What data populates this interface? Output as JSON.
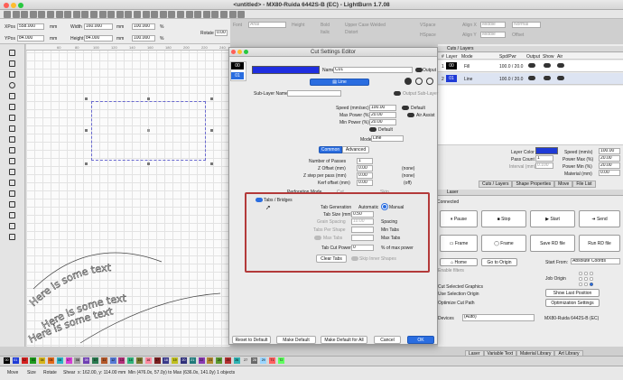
{
  "window": {
    "title": "<untitled> - MX80-Ruida 6442S-B (EC) - LightBurn 1.7.08"
  },
  "controls": {
    "xpos_label": "XPos",
    "xpos": "558.000",
    "ypos_label": "YPos",
    "ypos": "84.000",
    "unit": "mm",
    "width_label": "Width",
    "width": "160.000",
    "height_label": "Height",
    "height": "84.000",
    "pct1": "100.000",
    "pct2": "100.000",
    "pct_sym": "%",
    "rotate_label": "Rotate",
    "rotate": "0.00",
    "mm_btn": "mm"
  },
  "toolbar_text": {
    "font_label": "Font",
    "font_value": "Arial",
    "height_label": "Height",
    "bold": "Bold",
    "italic": "Italic",
    "upper_case": "Upper Case",
    "distort": "Distort",
    "welded": "Welded",
    "vspace_label": "VSpace",
    "hspace_label": "HSpace",
    "align_x": "Align X",
    "align_x_val": "Middle",
    "align_y": "Align Y",
    "align_y_val": "Middle",
    "offset_label": "Offset",
    "normal": "Normal"
  },
  "ruler": {
    "ticks": [
      "60",
      "80",
      "100",
      "120",
      "140",
      "160",
      "180",
      "200",
      "220",
      "240"
    ]
  },
  "canvas": {
    "text_line": "Here is some text"
  },
  "dialog": {
    "title": "Cut Settings Editor",
    "layers": [
      {
        "num": "00"
      },
      {
        "num": "01"
      }
    ],
    "name_label": "Name",
    "name_value": "C01",
    "output_label": "Output",
    "line_btn": "Line",
    "sublayer_label": "Sub-Layer Name",
    "output_sublayer": "Output Sub-Layer",
    "speed_label": "Speed (mm/sec)",
    "speed": "100.00",
    "default1": "Default",
    "maxpower_label": "Max Power (%)",
    "maxpower": "20.00",
    "air_assist": "Air Assist",
    "minpower_label": "Min Power (%)",
    "minpower": "20.00",
    "default2": "Default",
    "mode_label": "Mode",
    "mode_value": "Line",
    "tab_common": "Common",
    "tab_advanced": "Advanced",
    "passes_label": "Number of Passes",
    "passes": "1",
    "zoffset_label": "Z Offset (mm)",
    "zoffset": "0.00",
    "none1": "(none)",
    "zstep_label": "Z step per pass (mm)",
    "zstep": "0.00",
    "none2": "(none)",
    "kerf_label": "Kerf offset (mm)",
    "kerf": "0.00",
    "off": "(off)",
    "perf_label": "Perforation Mode",
    "perf_cut": "Cut",
    "perf_skip": "Skip",
    "tabs_title": "Tabs / Bridges",
    "tabgen_label": "Tab Generation",
    "automatic": "Automatic",
    "manual": "Manual",
    "tabsize_label": "Tab Size (mm)",
    "tabsize": "0.50",
    "grain_label": "Grain Spacing",
    "grain_val": "10.00",
    "spacing": "Spacing",
    "tabspershape_label": "Tabs Per Shape",
    "mintabs": "Min Tabs",
    "maxtabs_toggle": "Max Tabs",
    "maxtabs": "Max Tabs",
    "tabcut_label": "Tab Cut Power",
    "tabcut": "0",
    "pct_max": "% of max power",
    "clear_tabs": "Clear Tabs",
    "skip_inner": "Skip Inner Shapes",
    "reset": "Reset to Default",
    "make_default": "Make Default",
    "make_default_all": "Make Default for All",
    "cancel": "Cancel",
    "ok": "OK"
  },
  "cuts_panel": {
    "title": "Cuts / Layers",
    "headers": [
      "#",
      "Layer",
      "Mode",
      "Spd/Pwr",
      "Output",
      "Show",
      "Air"
    ],
    "rows": [
      {
        "num": "1",
        "layer": "00",
        "mode": "Fill",
        "spdpwr": "100.0 / 20.0"
      },
      {
        "num": "2",
        "layer": "01",
        "mode": "Line",
        "spdpwr": "100.0 / 20.0"
      }
    ],
    "layer_color": "Layer Color",
    "speed_label": "Speed (mm/s)",
    "speed": "100.00",
    "pass_count": "Pass Count",
    "pass_val": "1",
    "power_max": "Power Max (%)",
    "power_max_val": "20.00",
    "interval": "Interval (mm)",
    "interval_val": "0.100",
    "power_min": "Power Min (%)",
    "power_min_val": "20.00",
    "material": "Material (mm)",
    "material_val": "0.00",
    "tabs": [
      "Cuts / Layers",
      "Shape Properties",
      "Move",
      "File List"
    ]
  },
  "laser_panel": {
    "title": "Laser",
    "status": "Connected",
    "pause": "Pause",
    "stop": "Stop",
    "start": "Start",
    "send": "Send",
    "frame1": "Frame",
    "frame2": "Frame",
    "save_rd": "Save RD file",
    "run_rd": "Run RD file",
    "home": "Home",
    "go_origin": "Go to Origin",
    "start_from": "Start From:",
    "start_from_val": "Absolute Coords",
    "enable_filters": "Enable filters",
    "job_origin": "Job Origin",
    "cut_selected": "Cut Selected Graphics",
    "use_selection": "Use Selection Origin",
    "show_last": "Show Last Position",
    "optimize_path": "Optimize Cut Path",
    "optimize_settings": "Optimization Settings",
    "devices": "Devices",
    "auto": "(Auto)",
    "device": "MX80-Ruida 6442S-B (EC)",
    "tabs": [
      "Laser",
      "Variable Text",
      "Material Library",
      "Art Library"
    ]
  },
  "palette": [
    "00",
    "01",
    "02",
    "03",
    "04",
    "05",
    "06",
    "07",
    "08",
    "09",
    "10",
    "11",
    "12",
    "13",
    "14",
    "15",
    "16",
    "17",
    "18",
    "19",
    "20",
    "21",
    "22",
    "23",
    "24",
    "25",
    "26",
    "27",
    "28",
    "29",
    "T1",
    "T2"
  ],
  "palette_colors": [
    "#000000",
    "#1f3bd6",
    "#d42020",
    "#1d9a1d",
    "#d6b51a",
    "#e36a1a",
    "#2bb3c6",
    "#d63fd6",
    "#9e9e9e",
    "#6f3fb3",
    "#2a7a50",
    "#b3582a",
    "#567ad6",
    "#b3307a",
    "#30b37a",
    "#7a7a30",
    "#ff8aa0",
    "#7a2020",
    "#3a3a8a",
    "#c0c020",
    "#30307a",
    "#207a7a",
    "#8a3ab3",
    "#b38a30",
    "#5a9a30",
    "#b33030",
    "#30b3b3",
    "#d6d6d6",
    "#6a6a6a",
    "#9ad6ff",
    "#ff6060",
    "#60ff60"
  ],
  "statusbar": {
    "move": "Move",
    "size": "Size",
    "rotate": "Rotate",
    "shear": "Shear",
    "coords": "x: 162.00, y: 114.00 mm",
    "minmax": "Min (476.0x, 57.0y) to Max (636.0x, 141.0y)  1 objects"
  }
}
